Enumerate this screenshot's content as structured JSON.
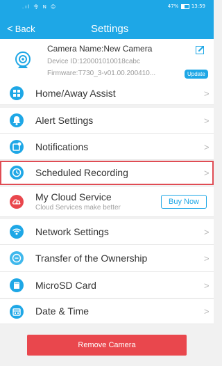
{
  "status_bar": {
    "left": ".ıl 令 N ☺",
    "battery_text": "47%",
    "battery_level": 0.47,
    "time": "13:59"
  },
  "nav": {
    "back_label": "Back",
    "title": "Settings"
  },
  "camera": {
    "name": "Camera Name:New Camera",
    "device_id": "Device ID:120001010018cabc",
    "firmware": "Firmware:T730_3-v01.00.200410...",
    "update_label": "Update"
  },
  "menu": {
    "home_away": "Home/Away Assist",
    "alert": "Alert Settings",
    "notifications": "Notifications",
    "scheduled": "Scheduled Recording",
    "cloud": "My Cloud Service",
    "cloud_sub": "Cloud Services make better",
    "buy_now": "Buy Now",
    "network": "Network Settings",
    "transfer": "Transfer of the Ownership",
    "microsd": "MicroSD Card",
    "datetime": "Date & Time"
  },
  "remove_label": "Remove Camera",
  "chevron": ">",
  "colors": {
    "accent": "#1ea7e6",
    "danger": "#e9474d",
    "highlight": "#e04c54"
  }
}
